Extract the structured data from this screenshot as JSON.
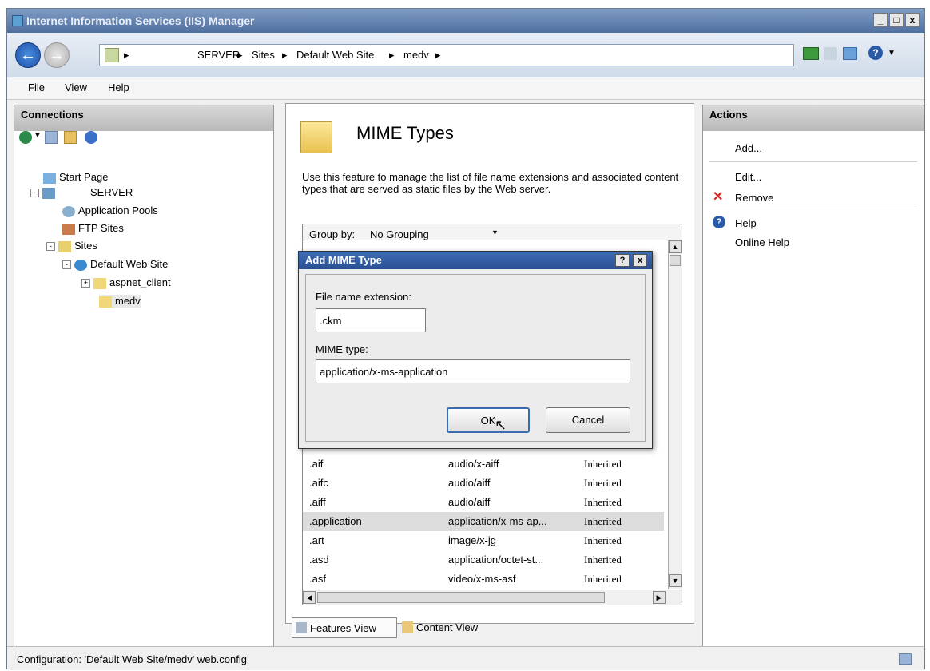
{
  "window": {
    "title": "Internet Information Services (IIS) Manager",
    "min": "_",
    "max": "□",
    "close": "x"
  },
  "address": {
    "crumbs": [
      "SERVER",
      "Sites",
      "Default Web Site",
      "medv"
    ],
    "sep": "▸"
  },
  "menu": {
    "file": "File",
    "view": "View",
    "help": "Help"
  },
  "connections": {
    "title": "Connections",
    "tree": {
      "start_page": "Start Page",
      "server": "SERVER",
      "app_pools": "Application Pools",
      "ftp_sites": "FTP Sites",
      "sites": "Sites",
      "default_web_site": "Default Web Site",
      "aspnet_client": "aspnet_client",
      "medv": "medv"
    }
  },
  "feature": {
    "title": "MIME Types",
    "description": "Use this feature to manage the list of file name extensions and associated content types that are served as static files by the Web server.",
    "group_by_label": "Group by:",
    "group_by_value": "No Grouping",
    "rows": [
      {
        "ext": ".aif",
        "type": "audio/x-aiff",
        "entry": "Inherited"
      },
      {
        "ext": ".aifc",
        "type": "audio/aiff",
        "entry": "Inherited"
      },
      {
        "ext": ".aiff",
        "type": "audio/aiff",
        "entry": "Inherited"
      },
      {
        "ext": ".application",
        "type": "application/x-ms-ap...",
        "entry": "Inherited"
      },
      {
        "ext": ".art",
        "type": "image/x-jg",
        "entry": "Inherited"
      },
      {
        "ext": ".asd",
        "type": "application/octet-st...",
        "entry": "Inherited"
      },
      {
        "ext": ".asf",
        "type": "video/x-ms-asf",
        "entry": "Inherited"
      }
    ],
    "features_view": "Features View",
    "content_view": "Content View"
  },
  "actions": {
    "title": "Actions",
    "add": "Add...",
    "edit": "Edit...",
    "remove": "Remove",
    "help": "Help",
    "online_help": "Online Help"
  },
  "dialog": {
    "title": "Add MIME Type",
    "help_btn": "?",
    "close_btn": "x",
    "ext_label": "File name extension:",
    "ext_value": ".ckm",
    "mime_label": "MIME type:",
    "mime_value": "application/x-ms-application",
    "ok": "OK",
    "cancel": "Cancel"
  },
  "status": {
    "text": "Configuration: 'Default Web Site/medv' web.config"
  },
  "colors": {
    "title_bar": "#4f6f9f",
    "dialog_title": "#2a4f93",
    "remove_x": "#d42020",
    "selected_row": "#dcdcdc"
  }
}
